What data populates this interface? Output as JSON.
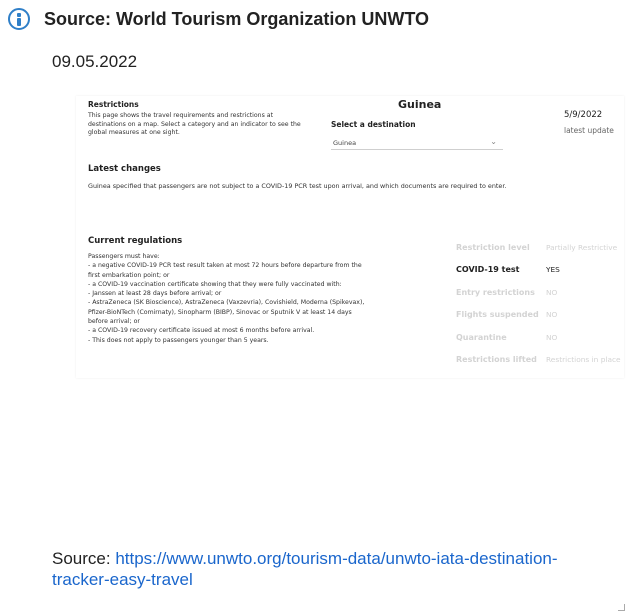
{
  "header": {
    "title": "Source: World Tourism Organization UNWTO",
    "date": "09.05.2022",
    "icon": "info-icon"
  },
  "embed": {
    "restrictions_heading": "Restrictions",
    "restrictions_desc": "This page shows the travel requirements and restrictions at destinations on a map. Select a category and an indicator to see the global measures at one sight.",
    "country": "Guinea",
    "select_label": "Select a destination",
    "select_value": "Guinea",
    "update_date": "5/9/2022",
    "update_label": "latest update",
    "latest_heading": "Latest changes",
    "latest_text": "Guinea specified that passengers are not subject to a COVID-19 PCR test upon arrival, and which documents are required to enter.",
    "current_heading": "Current regulations",
    "regulations": [
      "Passengers must have:",
      "- a negative COVID-19 PCR test result taken at most 72 hours before departure from the",
      "first embarkation point; or",
      "- a COVID-19 vaccination certificate showing that they were fully vaccinated with:",
      "- Janssen at least 28 days before arrival; or",
      "- AstraZeneca (SK Bioscience), AstraZeneca (Vaxzevria), Covishield, Moderna (Spikevax),",
      "Pfizer-BioNTech (Comirnaty), Sinopharm (BIBP), Sinovac or Sputnik V at least 14 days",
      "before arrival; or",
      "- a COVID-19 recovery certificate issued at most 6 months before arrival.",
      "- This does not apply to passengers younger than 5 years."
    ],
    "status": [
      {
        "key": "Restriction level",
        "value": "Partially Restrictive",
        "active": false
      },
      {
        "key": "COVID-19 test",
        "value": "YES",
        "active": true
      },
      {
        "key": "Entry restrictions",
        "value": "NO",
        "active": false
      },
      {
        "key": "Flights suspended",
        "value": "NO",
        "active": false
      },
      {
        "key": "Quarantine",
        "value": "NO",
        "active": false
      },
      {
        "key": "Restrictions lifted",
        "value": "Restrictions in place",
        "active": false
      }
    ]
  },
  "footer": {
    "prefix": "Source: ",
    "link": "https://www.unwto.org/tourism-data/unwto-iata-destination-tracker-easy-travel"
  },
  "colors": {
    "accent": "#2f7fc8",
    "link": "#1a66cc",
    "muted": "#d3d3d3"
  }
}
